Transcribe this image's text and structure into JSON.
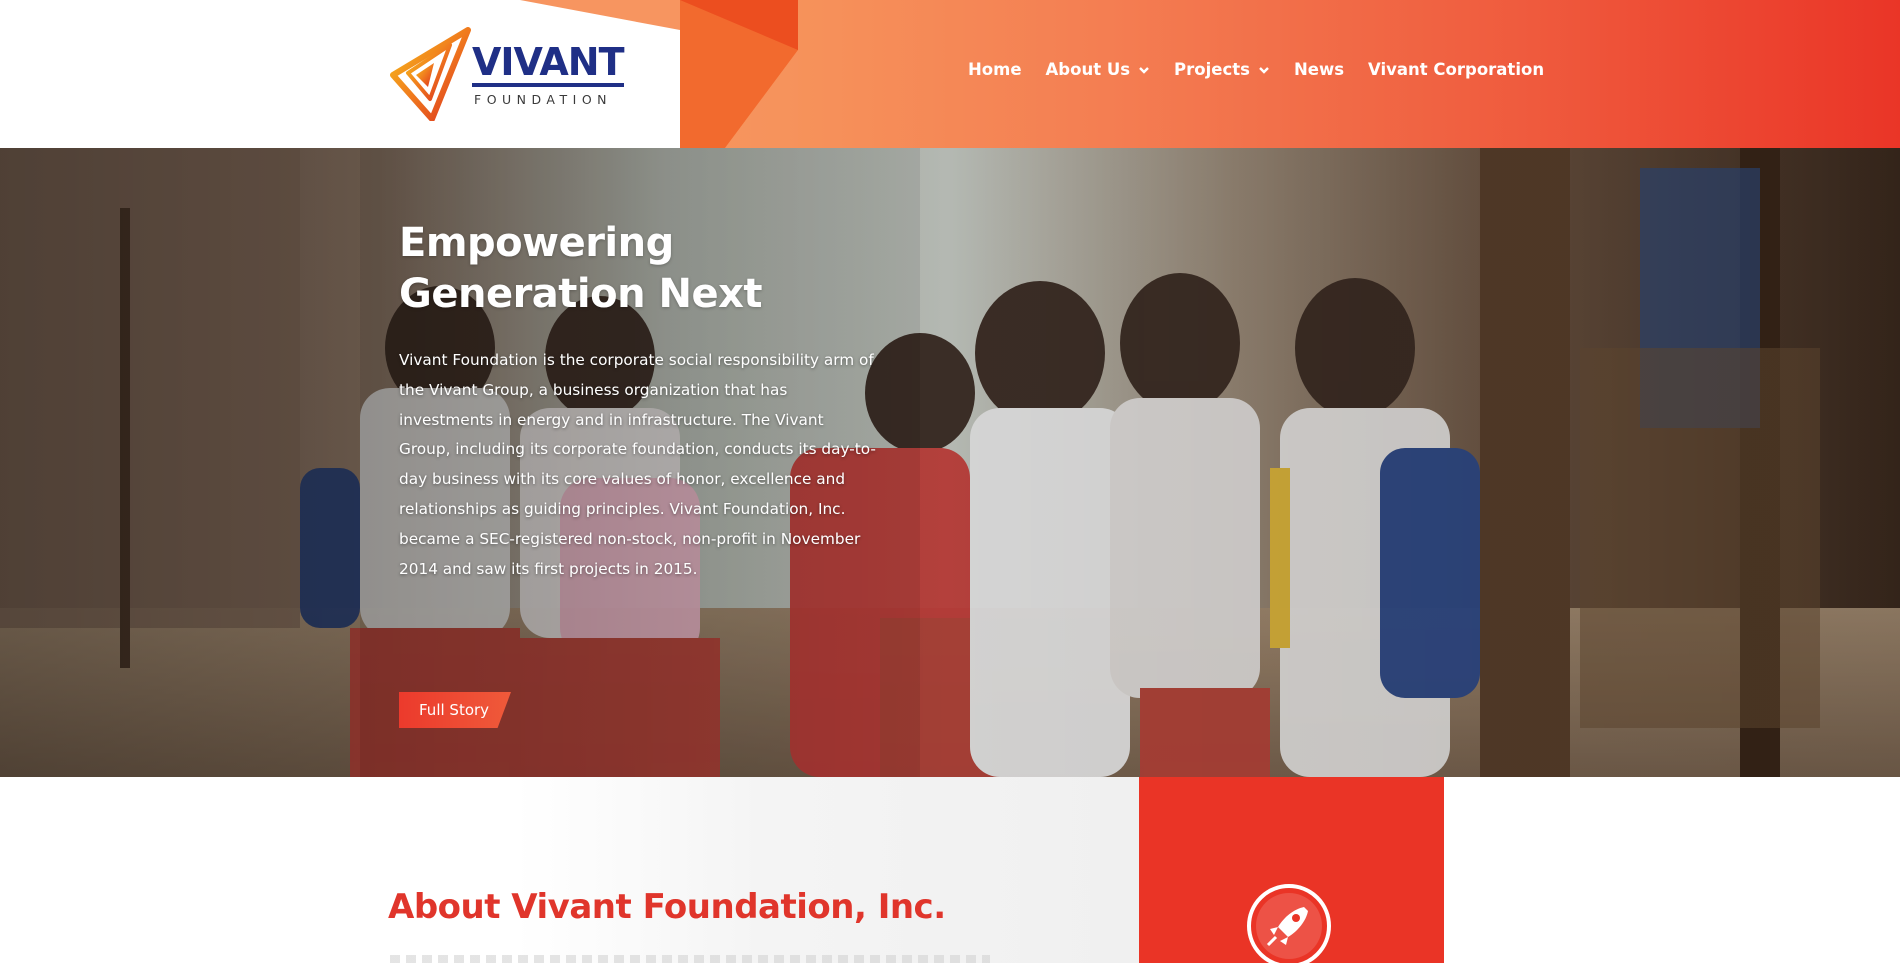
{
  "brand": {
    "name": "VIVANT",
    "subtitle": "FOUNDATION",
    "logo_icon": "vivant-triangle-logo",
    "primary_color": "#1f2f86",
    "accent_color": "#ea3426"
  },
  "nav": {
    "items": [
      {
        "label": "Home",
        "has_dropdown": false
      },
      {
        "label": "About Us",
        "has_dropdown": true
      },
      {
        "label": "Projects",
        "has_dropdown": true
      },
      {
        "label": "News",
        "has_dropdown": false
      },
      {
        "label": "Vivant Corporation",
        "has_dropdown": false
      }
    ]
  },
  "hero": {
    "title_line1": "Empowering",
    "title_line2": "Generation Next",
    "body": "Vivant Foundation is the corporate social responsibility arm of the Vivant Group, a business organization that has investments in energy and in infrastructure. The Vivant Group, including its corporate foundation, conducts its day-to-day business with its core values of honor, excellence and relationships as guiding principles. Vivant Foundation, Inc. became a SEC-registered non-stock, non-profit in November 2014 and saw its first projects in 2015.",
    "cta_label": "Full Story",
    "photo_description_icon": "schoolchildren-photo"
  },
  "about": {
    "title": "About Vivant Foundation, Inc.",
    "card_icon": "rocket-icon"
  }
}
